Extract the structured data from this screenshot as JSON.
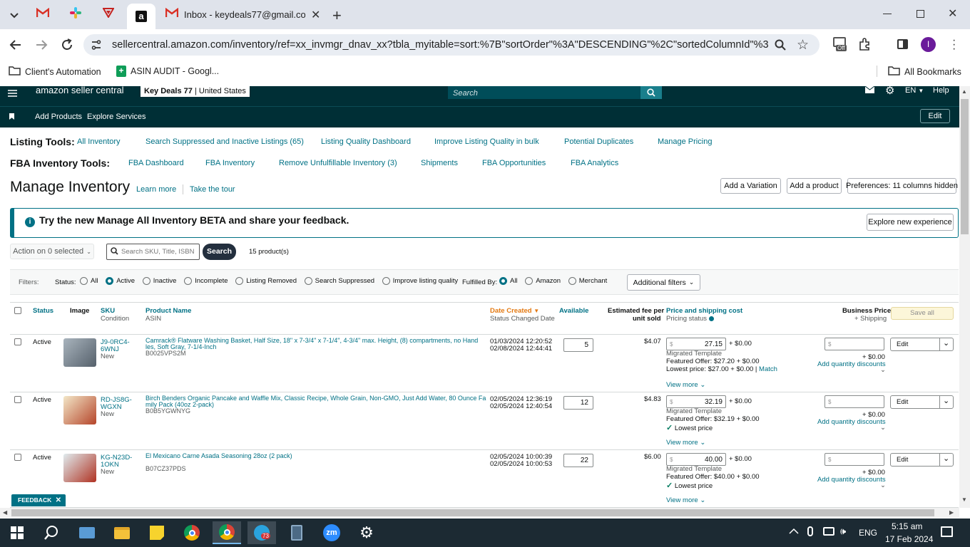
{
  "browser": {
    "tabs": [
      {
        "title": ""
      },
      {
        "title": ""
      },
      {
        "title": ""
      },
      {
        "title": ""
      },
      {
        "title": "Inbox - keydeals77@gmail.com"
      }
    ],
    "url": "sellercentral.amazon.com/inventory/ref=xx_invmgr_dnav_xx?tbla_myitable=sort:%7B\"sortOrder\"%3A\"DESCENDING\"%2C\"sortedColumnId\"%3A\"date...",
    "profile_initial": "I",
    "ext_badge": "Off",
    "bookmarks": [
      "Client's Automation",
      "ASIN AUDIT - Googl..."
    ],
    "all_bookmarks": "All Bookmarks"
  },
  "header": {
    "logo": "amazon seller central",
    "store": "Key Deals 77",
    "marketplace": "United States",
    "search_placeholder": "Search",
    "lang": "EN",
    "help": "Help",
    "nav": [
      "Add Products",
      "Explore Services"
    ],
    "edit": "Edit"
  },
  "listing_tools": {
    "label": "Listing Tools:",
    "links": [
      "All Inventory",
      "Search Suppressed and Inactive Listings (65)",
      "Listing Quality Dashboard",
      "Improve Listing Quality in bulk",
      "Potential Duplicates",
      "Manage Pricing"
    ]
  },
  "fba_tools": {
    "label": "FBA Inventory Tools:",
    "links": [
      "FBA Dashboard",
      "FBA Inventory",
      "Remove Unfulfillable Inventory (3)",
      "Shipments",
      "FBA Opportunities",
      "FBA Analytics"
    ]
  },
  "page": {
    "title": "Manage Inventory",
    "learn_more": "Learn more",
    "take_tour": "Take the tour",
    "add_variation": "Add a Variation",
    "add_product": "Add a product",
    "preferences": "Preferences: 11 columns hidden"
  },
  "banner": {
    "text": "Try the new Manage All Inventory BETA and share your feedback.",
    "button": "Explore new experience"
  },
  "toolbar": {
    "action": "Action on 0 selected",
    "search_placeholder": "Search SKU, Title, ISBN",
    "search_btn": "Search",
    "count": "15 product(s)"
  },
  "filters": {
    "label": "Filters:",
    "status_label": "Status:",
    "status": [
      "All",
      "Active",
      "Inactive",
      "Incomplete",
      "Listing Removed",
      "Search Suppressed",
      "Improve listing quality"
    ],
    "fulfilled_label": "Fulfilled By:",
    "fulfilled": [
      "All",
      "Amazon",
      "Merchant"
    ],
    "additional": "Additional filters"
  },
  "columns": {
    "status": "Status",
    "image": "Image",
    "sku": "SKU",
    "condition": "Condition",
    "product_name": "Product Name",
    "asin": "ASIN",
    "date_created": "Date Created",
    "status_changed": "Status Changed Date",
    "available": "Available",
    "fee1": "Estimated fee per",
    "fee2": "unit sold",
    "price": "Price and shipping cost",
    "pricing_status": "Pricing status",
    "business_price": "Business Price",
    "plus_shipping": "+ Shipping",
    "save_all": "Save all"
  },
  "rows": [
    {
      "status": "Active",
      "sku1": "J9-0RC4-",
      "sku2": "6WNJ",
      "condition": "New",
      "name1": "Camrack® Flatware Washing Basket, Half Size, 18\" x 7-3/4\" x 7-1/4\", 4-3/4\" max. Height, (8) compartments, no Hand",
      "name2": "les, Soft Gray, 7-1/4-Inch",
      "asin": "B0025VPS2M",
      "date1": "01/03/2024 12:20:52",
      "date2": "02/08/2024 12:44:41",
      "available": "5",
      "fee": "$4.07",
      "price": "27.15",
      "ship": "+ $0.00",
      "template": "Migrated Template",
      "featured": "Featured Offer: $27.20 + $0.00",
      "lowest": "Lowest price: $27.00 + $0.00",
      "match": "Match",
      "bp_ship": "+ $0.00",
      "qty_disc": "Add quantity discounts",
      "edit": "Edit",
      "view_more": "View more"
    },
    {
      "status": "Active",
      "sku1": "RD-JS8G-",
      "sku2": "WGXN",
      "condition": "New",
      "name1": "Birch Benders Organic Pancake and Waffle Mix, Classic Recipe, Whole Grain, Non-GMO, Just Add Water, 80 Ounce Fa",
      "name2": "mily Pack (40oz 2-pack)",
      "asin": "B0B5YGWNYG",
      "date1": "02/05/2024 12:36:19",
      "date2": "02/05/2024 12:40:54",
      "available": "12",
      "fee": "$4.83",
      "price": "32.19",
      "ship": "+ $0.00",
      "template": "Migrated Template",
      "featured": "Featured Offer: $32.19 + $0.00",
      "lowest": "Lowest price",
      "match": "",
      "bp_ship": "+ $0.00",
      "qty_disc": "Add quantity discounts",
      "edit": "Edit",
      "view_more": "View more"
    },
    {
      "status": "Active",
      "sku1": "KG-N23D-",
      "sku2": "1OKN",
      "condition": "New",
      "name1": "El Mexicano Carne Asada Seasoning 28oz (2 pack)",
      "name2": "",
      "asin": "B07CZ37PDS",
      "date1": "02/05/2024 10:00:39",
      "date2": "02/05/2024 10:00:53",
      "available": "22",
      "fee": "$6.00",
      "price": "40.00",
      "ship": "+ $0.00",
      "template": "Migrated Template",
      "featured": "Featured Offer: $40.00 + $0.00",
      "lowest": "Lowest price",
      "match": "",
      "bp_ship": "+ $0.00",
      "qty_disc": "Add quantity discounts",
      "edit": "Edit",
      "view_more": "View more"
    }
  ],
  "currency": "$",
  "feedback": "FEEDBACK",
  "taskbar": {
    "lang": "ENG",
    "time": "5:15 am",
    "date": "17 Feb 2024",
    "telegram_badge": "73"
  },
  "colors": {
    "header": "#002f36",
    "link": "#007185",
    "accent": "#e47911"
  }
}
